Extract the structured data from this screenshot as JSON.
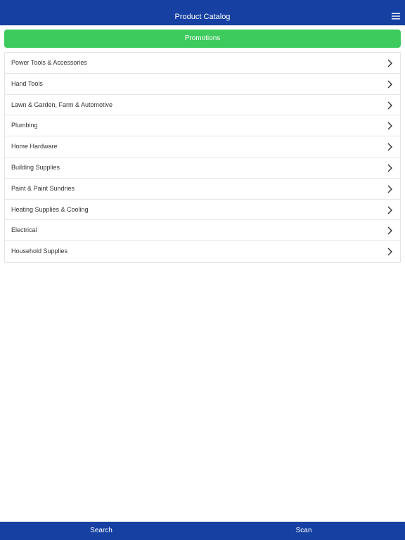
{
  "header": {
    "title": "Product Catalog",
    "menu_icon": "hamburger-menu-icon"
  },
  "promotions": {
    "label": "Promotions"
  },
  "categories": [
    {
      "label": "Power Tools & Accessories"
    },
    {
      "label": "Hand Tools"
    },
    {
      "label": "Lawn & Garden, Farm & Automotive"
    },
    {
      "label": "Plumbing"
    },
    {
      "label": "Home Hardware"
    },
    {
      "label": "Building Supplies"
    },
    {
      "label": "Paint & Paint Sundries"
    },
    {
      "label": "Heating Supplies & Cooling"
    },
    {
      "label": "Electrical"
    },
    {
      "label": "Household Supplies"
    }
  ],
  "bottom_bar": {
    "search_label": "Search",
    "scan_label": "Scan"
  },
  "colors": {
    "header_bg": "#1641a3",
    "promo_bg": "#3ecb5d",
    "text": "#333333"
  }
}
